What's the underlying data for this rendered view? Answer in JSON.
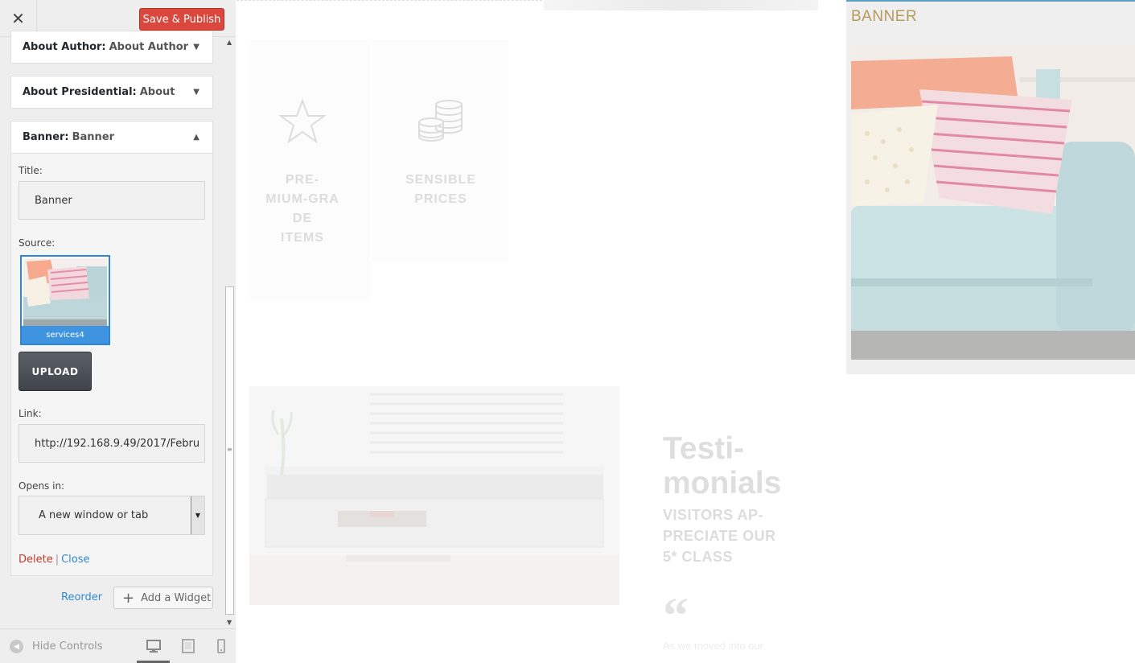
{
  "topbar": {
    "close_icon": "close-icon",
    "save_label": "Save & Publish"
  },
  "widgets": [
    {
      "type": "About Author:",
      "name": "About Author"
    },
    {
      "type": "About Presidential:",
      "name": "About"
    }
  ],
  "banner_widget": {
    "type": "Banner:",
    "name": "Banner",
    "title_label": "Title:",
    "title_value": "Banner",
    "source_label": "Source:",
    "source_caption": "services4",
    "upload_label": "UPLOAD",
    "link_label": "Link:",
    "link_value": "http://192.168.9.49/2017/Febru",
    "opens_label": "Opens in:",
    "opens_value": "A new window or tab",
    "delete_label": "Delete",
    "separator": "|",
    "close_label": "Close"
  },
  "panel_actions": {
    "reorder_label": "Reorder",
    "add_widget_label": "Add a Widget"
  },
  "footer": {
    "hide_controls_label": "Hide Controls"
  },
  "preview": {
    "feature1_lines": [
      "PRE-",
      "MIUM-GRA",
      "DE",
      "ITEMS"
    ],
    "feature2_lines": [
      "SENSIBLE",
      "PRICES"
    ],
    "testimonials_title_lines": [
      "Testi-",
      "monials"
    ],
    "testimonials_sub_lines": [
      "VISITORS AP-",
      "PRECIATE OUR",
      "5* CLASS"
    ],
    "quote_glyph": "“",
    "testimonial_snippet": "As we moved into our",
    "banner_heading": "BANNER"
  },
  "colors": {
    "save": "#d9473d",
    "link_blue": "#2f8bcf",
    "delete_red": "#c0392b",
    "banner_gold": "#b59a5b"
  }
}
